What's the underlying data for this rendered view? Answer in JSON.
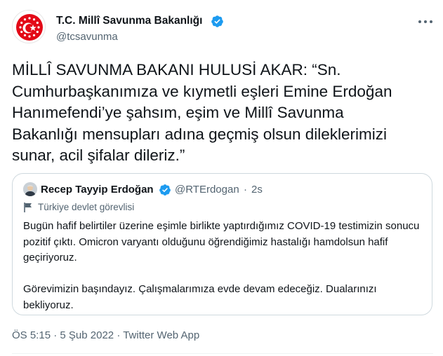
{
  "author": {
    "name": "T.C. Millî Savunma Bakanlığı",
    "handle": "@tcsavunma",
    "verified": true
  },
  "tweet": {
    "text": "MİLLÎ SAVUNMA BAKANI HULUSİ AKAR: “Sn.\nCumhurbaşkanımıza ve kıymetli eşleri Emine Erdoğan\nHanımefendi’ye şahsım, eşim ve Millî Savunma\nBakanlığı mensupları adına geçmiş olsun dileklerimizi\nsunar, acil şifalar dileriz.”"
  },
  "quote": {
    "name": "Recep Tayyip Erdoğan",
    "handle": "@RTErdogan",
    "separator": "·",
    "time": "2s",
    "label": "Türkiye devlet görevlisi",
    "paragraph1": "Bugün hafif belirtiler üzerine eşimle birlikte yaptırdığımız COVID-19 testimizin sonucu pozitif çıktı. Omicron varyantı olduğunu öğrendiğimiz hastalığı hamdolsun hafif geçiriyoruz.",
    "paragraph2": "Görevimizin başındayız. Çalışmalarımıza evde devam edeceğiz. Dualarınızı bekliyoruz."
  },
  "meta": {
    "time": "ÖS 5:15",
    "dot1": "·",
    "date": "5 Şub 2022",
    "dot2": "·",
    "source": "Twitter Web App"
  },
  "colors": {
    "verified": "#1d9bf0",
    "text_primary": "#0f1419",
    "text_secondary": "#536471",
    "emblem_red": "#e30a17",
    "border": "#cfd9de"
  },
  "icons": {
    "more": "more-horizontal-icon",
    "verified": "verified-badge-icon",
    "flag": "flag-icon"
  }
}
